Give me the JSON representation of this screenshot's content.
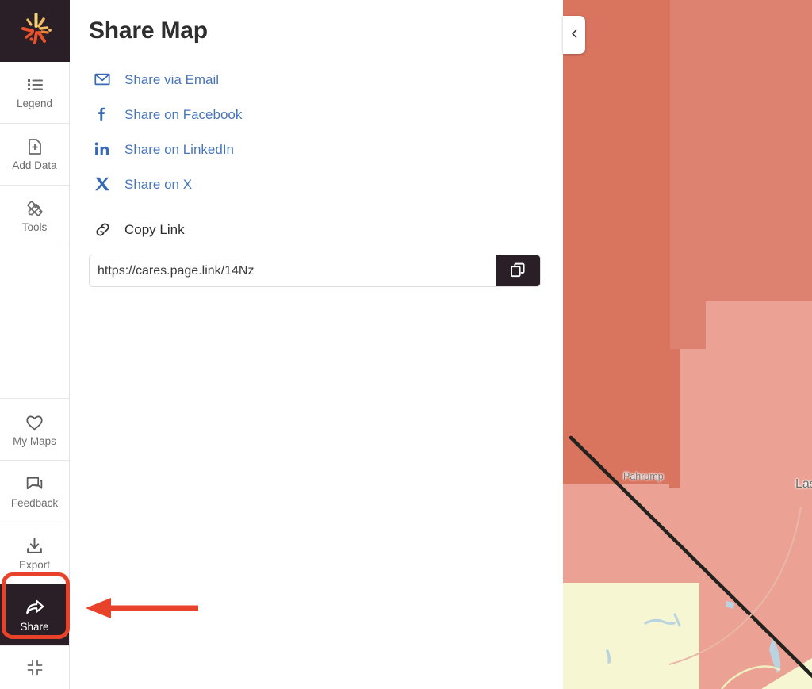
{
  "app": {
    "logo_icon": "starburst-logo-icon",
    "logo_bg": "#2a1f27",
    "accent_highlight": "#e8432a"
  },
  "sidebar": {
    "items": [
      {
        "label": "Legend",
        "icon": "list-legend-icon",
        "active": false
      },
      {
        "label": "Add Data",
        "icon": "file-plus-icon",
        "active": false
      },
      {
        "label": "Tools",
        "icon": "ruler-pencil-icon",
        "active": false
      },
      {
        "label": "My Maps",
        "icon": "heart-icon",
        "active": false
      },
      {
        "label": "Feedback",
        "icon": "chat-bubble-icon",
        "active": false
      },
      {
        "label": "Export",
        "icon": "download-icon",
        "active": false
      },
      {
        "label": "Share",
        "icon": "share-arrow-icon",
        "active": true
      }
    ],
    "fullscreen_icon": "exit-fullscreen-icon"
  },
  "panel": {
    "title": "Share Map",
    "options": [
      {
        "label": "Share via Email",
        "icon": "envelope-icon"
      },
      {
        "label": "Share on Facebook",
        "icon": "facebook-icon"
      },
      {
        "label": "Share on LinkedIn",
        "icon": "linkedin-icon"
      },
      {
        "label": "Share on X",
        "icon": "x-twitter-icon"
      }
    ],
    "copy_link": {
      "label": "Copy Link",
      "icon": "link-chain-icon",
      "url": "https://cares.page.link/14Nz",
      "placeholder": "https://cares.page.link/14Nz",
      "copy_button_icon": "copy-icon"
    },
    "link_color": "#4a76b8"
  },
  "map": {
    "collapse_icon": "chevron-left-icon",
    "labels": [
      {
        "name": "Pahrump",
        "size": "small"
      },
      {
        "name": "Las",
        "size": "big"
      }
    ],
    "colors": {
      "choropleth_dark": "#D9745F",
      "choropleth_mid": "#DE8673",
      "choropleth_light": "#EBA294",
      "desert_yellow": "#F6F6D2",
      "water": "#B9D4E0",
      "state_border": "#22221f"
    }
  },
  "annotation": {
    "type": "arrow",
    "color": "#e8432a",
    "points_to": "share-sidebar-item"
  }
}
